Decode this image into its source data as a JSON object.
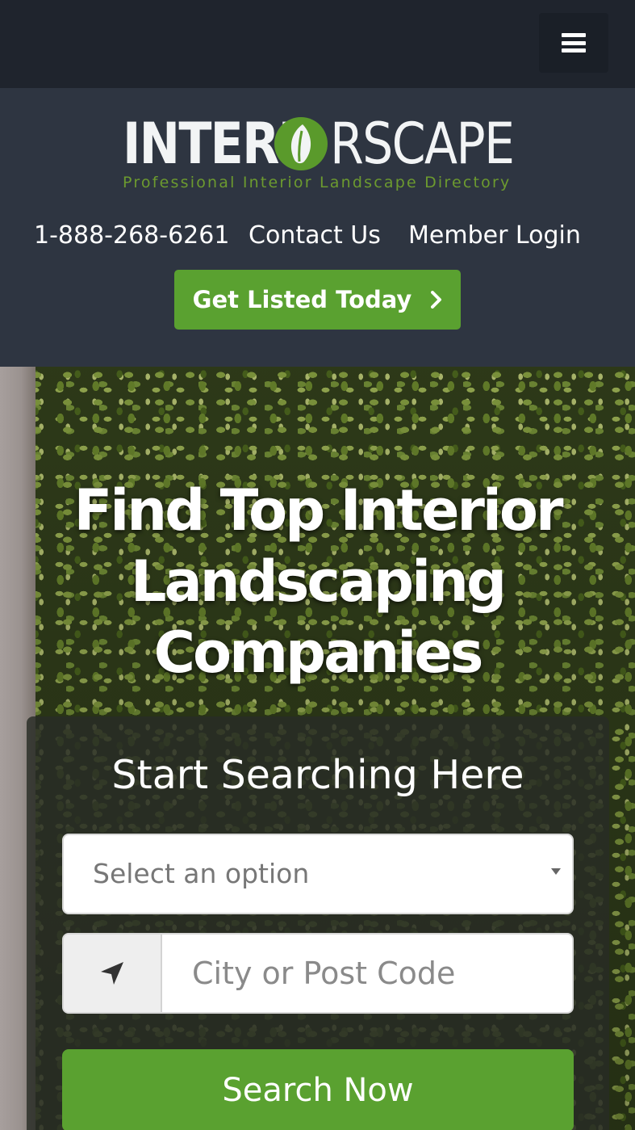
{
  "topbar": {
    "menu_icon": "hamburger-menu-icon"
  },
  "logo": {
    "word_left": "INTERI",
    "word_right": "RSCAPE",
    "leaf_icon": "leaf-icon",
    "tagline": "Professional Interior Landscape Directory",
    "colors": {
      "text": "#f2f4f5",
      "leaf": "#5a9a2b",
      "tagline": "#6c9a2f"
    }
  },
  "nav": {
    "phone": "1-888-268-6261",
    "contact": "Contact Us",
    "login": "Member Login"
  },
  "cta": {
    "label": "Get Listed Today",
    "icon": "chevron-right-icon",
    "color": "#5aa130"
  },
  "hero": {
    "title": "Find Top Interior Landscaping Companies"
  },
  "search": {
    "heading": "Start Searching Here",
    "select_placeholder": "Select an option",
    "location_icon": "location-arrow-icon",
    "location_placeholder": "City or Post Code",
    "button_label": "Search Now",
    "button_color": "#5aa130"
  }
}
